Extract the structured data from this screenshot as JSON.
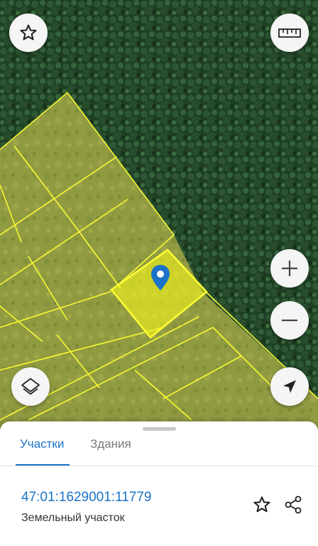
{
  "map": {
    "satellite_colors": {
      "forest": "#23452a",
      "field": "#7f8a46"
    },
    "parcel_stroke": "#ffff33",
    "selected_fill": "#ffff1a",
    "accent": "#1a73c8"
  },
  "controls": {
    "favorite_icon": "star-icon",
    "ruler_icon": "ruler-icon",
    "zoom_in_icon": "plus-icon",
    "zoom_out_icon": "minus-icon",
    "layers_icon": "layers-icon",
    "locate_icon": "navigation-arrow-icon"
  },
  "sheet": {
    "tabs": [
      {
        "label": "Участки",
        "active": true
      },
      {
        "label": "Здания",
        "active": false
      }
    ],
    "parcel": {
      "cadastral_number": "47:01:1629001:11779",
      "type": "Земельный участок"
    }
  }
}
